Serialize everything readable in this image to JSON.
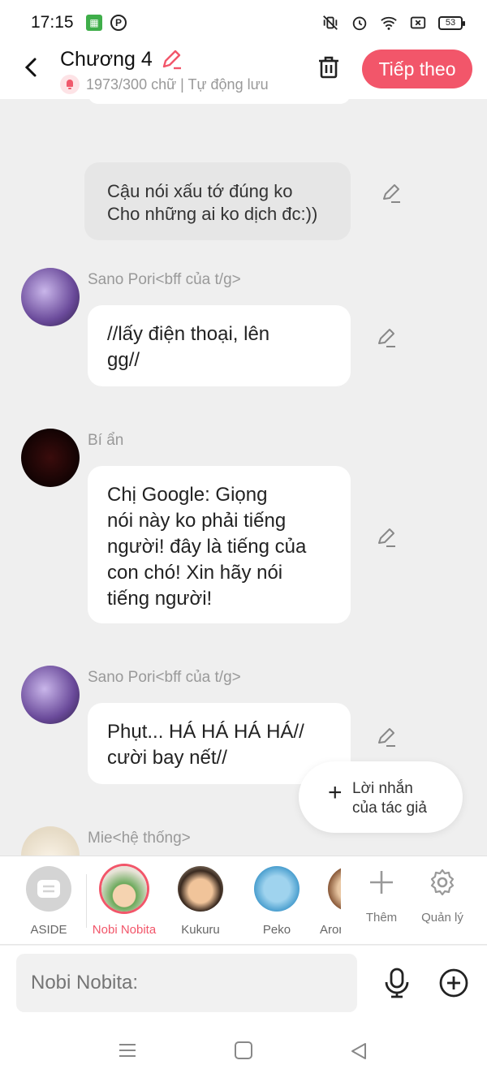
{
  "status_bar": {
    "time": "17:15",
    "battery": "53"
  },
  "header": {
    "title": "Chương 4",
    "subtitle": "1973/300 chữ | Tự động lưu",
    "next_label": "Tiếp theo"
  },
  "messages": [
    {
      "type": "aside",
      "text_lines": [
        "Cậu nói xấu tớ đúng ko",
        "Cho những ai ko dịch đc:))"
      ]
    },
    {
      "type": "char",
      "name": "Sano Pori<bff của t/g>",
      "text_lines": [
        "//lấy điện thoại, lên",
        "gg//"
      ]
    },
    {
      "type": "char",
      "name": "Bí ẩn",
      "text_lines": [
        "Chị Google: Giọng",
        "nói này ko phải tiếng",
        "người! đây là tiếng của",
        "con chó! Xin hãy nói",
        "tiếng người!"
      ]
    },
    {
      "type": "char",
      "name": "Sano Pori<bff của t/g>",
      "text_lines": [
        "Phụt... HÁ HÁ HÁ HÁ//",
        "cười bay nết//"
      ]
    },
    {
      "type": "char",
      "name": "Mie<hệ thống>"
    }
  ],
  "author_note_button": {
    "line1": "Lời nhắn",
    "line2": "của tác giả"
  },
  "characters": [
    {
      "label": "ASIDE"
    },
    {
      "label": "Nobi Nobita",
      "selected": true
    },
    {
      "label": "Kukuru"
    },
    {
      "label": "Peko"
    },
    {
      "label": "Aron"
    }
  ],
  "tools": {
    "add_label": "Thêm",
    "manage_label": "Quản lý"
  },
  "input": {
    "placeholder": "Nobi Nobita:"
  },
  "colors": {
    "accent": "#f2566a",
    "background": "#efefef"
  }
}
